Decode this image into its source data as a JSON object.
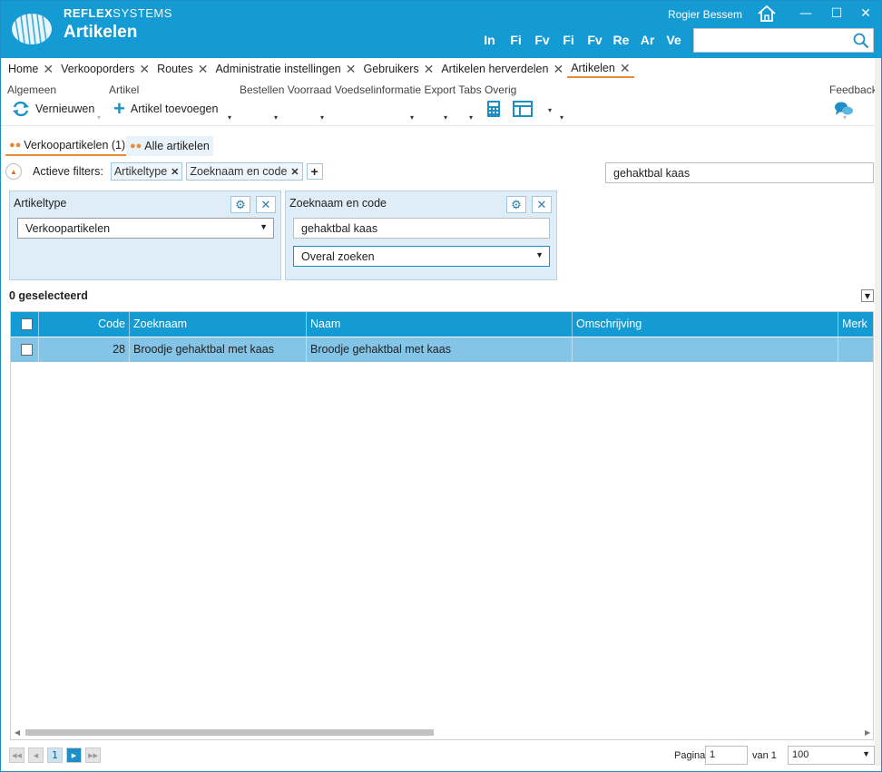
{
  "header": {
    "brand_bold": "REFLEX",
    "brand_rest": "SYSTEMS",
    "title": "Artikelen",
    "user": "Rogier Bessem",
    "shortcuts": [
      "In",
      "Fi",
      "Fv",
      "Fi",
      "Fv",
      "Re",
      "Ar",
      "Ve"
    ],
    "search_value": ""
  },
  "tabs": [
    "Home",
    "Verkooporders",
    "Routes",
    "Administratie instellingen",
    "Gebruikers",
    "Artikelen herverdelen",
    "Artikelen"
  ],
  "ribbon": {
    "groups": {
      "algemeen": "Algemeen",
      "artikel": "Artikel",
      "rest": "Bestellen Voorraad Voedselinformatie Export Tabs Overig",
      "feedback": "Feedback"
    },
    "refresh_label": "Vernieuwen",
    "add_label": "Artikel toevoegen"
  },
  "subtabs": {
    "sales": "Verkoopartikelen (1)",
    "all": "Alle artikelen"
  },
  "filters": {
    "label": "Actieve filters:",
    "chips": [
      "Artikeltype",
      "Zoeknaam en code"
    ],
    "search_value": "gehaktbal kaas"
  },
  "panels": {
    "type": {
      "title": "Artikeltype",
      "value": "Verkoopartikelen"
    },
    "search": {
      "title": "Zoeknaam en code",
      "input": "gehaktbal kaas",
      "mode": "Overal zoeken"
    }
  },
  "grid": {
    "selected": "0 geselecteerd",
    "columns": {
      "code": "Code",
      "zoeknaam": "Zoeknaam",
      "naam": "Naam",
      "omschrijving": "Omschrijving",
      "merk": "Merk"
    },
    "rows": [
      {
        "code": "28",
        "zoeknaam": "Broodje gehaktbal met kaas",
        "naam": "Broodje gehaktbal met kaas",
        "omschrijving": "",
        "merk": ""
      }
    ]
  },
  "pager": {
    "current": "1",
    "label_page": "Pagina",
    "page_value": "1",
    "label_of": "van 1",
    "page_size": "100"
  },
  "colors": {
    "header": "#159bd3",
    "accent": "#ea8b3a",
    "row_selected": "#83c4e7"
  }
}
